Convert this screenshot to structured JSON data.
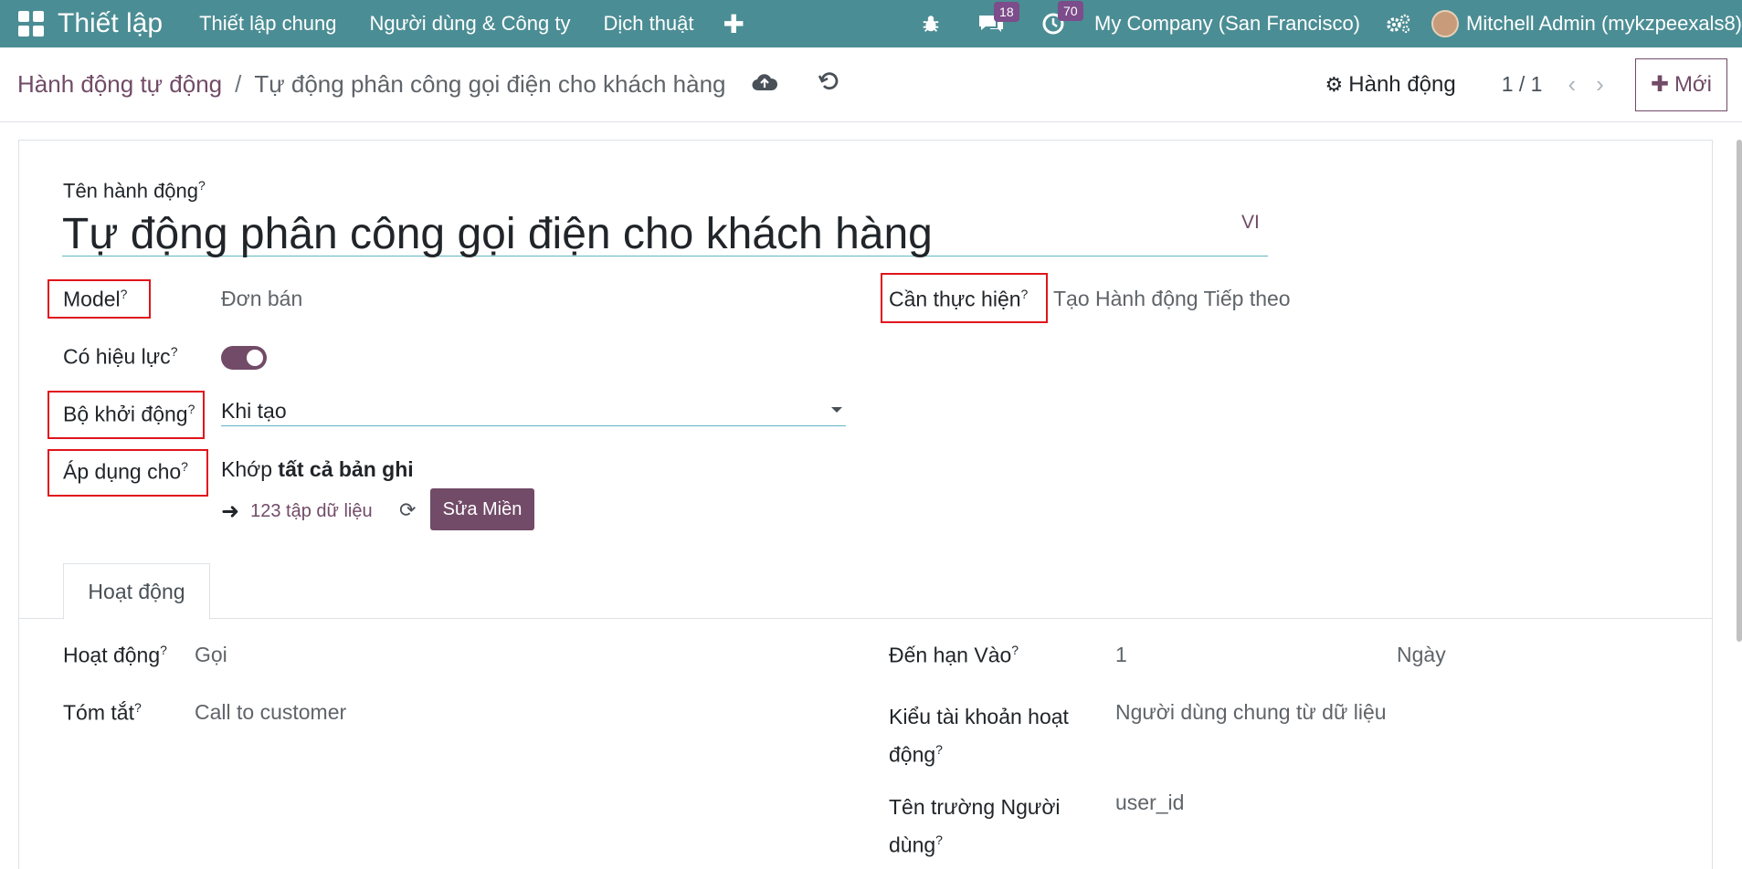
{
  "navbar": {
    "app_title": "Thiết lập",
    "menu": [
      "Thiết lập chung",
      "Người dùng & Công ty",
      "Dịch thuật"
    ],
    "messages_count": "18",
    "activities_count": "70",
    "company": "My Company (San Francisco)",
    "user": "Mitchell Admin (mykzpeexals8)"
  },
  "breadcrumb": {
    "parent": "Hành động tự động",
    "separator": "/",
    "current": "Tự động phân công gọi điện cho khách hàng"
  },
  "control": {
    "action_label": "Hành động",
    "pager": "1 / 1",
    "new_label": "Mới"
  },
  "form": {
    "name_label": "Tên hành động",
    "name_value": "Tự động phân công gọi điện cho khách hàng",
    "lang": "VI",
    "model_label": "Model",
    "model_value": "Đơn bán",
    "todo_label": "Cần thực hiện",
    "todo_value": "Tạo Hành động Tiếp theo",
    "active_label": "Có hiệu lực",
    "active": true,
    "trigger_label": "Bộ khởi động",
    "trigger_value": "Khi tạo",
    "apply_label": "Áp dụng cho",
    "apply_prefix": "Khớp",
    "apply_bold": "tất cả bản ghi",
    "records_text": "123 tập dữ liệu",
    "edit_domain": "Sửa Miền",
    "help_mark": "?"
  },
  "tab": {
    "label": "Hoạt động"
  },
  "activity": {
    "type_label": "Hoạt động",
    "type_value": "Gọi",
    "summary_label": "Tóm tắt",
    "summary_value": "Call to customer",
    "due_label": "Đến hạn Vào",
    "due_value": "1",
    "due_unit": "Ngày",
    "user_type_label_1": "Kiểu tài khoản hoạt",
    "user_type_label_2": "động",
    "user_type_value": "Người dùng chung từ dữ liệu",
    "user_field_label_1": "Tên trường Người",
    "user_field_label_2": "dùng",
    "user_field_value": "user_id"
  }
}
